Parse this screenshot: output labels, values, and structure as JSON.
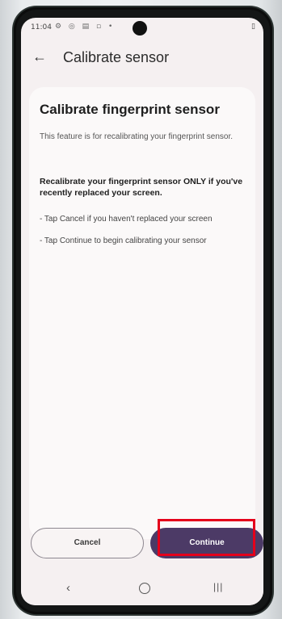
{
  "status_bar": {
    "time": "11:04",
    "icons": "⚙ ◎ ▤ ▫ •",
    "battery": "▯"
  },
  "app_bar": {
    "back_icon": "←",
    "title": "Calibrate sensor"
  },
  "content": {
    "heading": "Calibrate fingerprint sensor",
    "description": "This feature is for recalibrating your fingerprint sensor.",
    "warning": "Recalibrate your fingerprint sensor ONLY if you've recently replaced your screen.",
    "instruction_cancel": "- Tap Cancel if you haven't replaced your screen",
    "instruction_continue": "- Tap Continue to begin calibrating your sensor"
  },
  "buttons": {
    "cancel_label": "Cancel",
    "continue_label": "Continue"
  },
  "nav_bar": {
    "back": "‹",
    "recents": "|||"
  },
  "colors": {
    "accent": "#4c3a66",
    "highlight": "#e4001b"
  }
}
